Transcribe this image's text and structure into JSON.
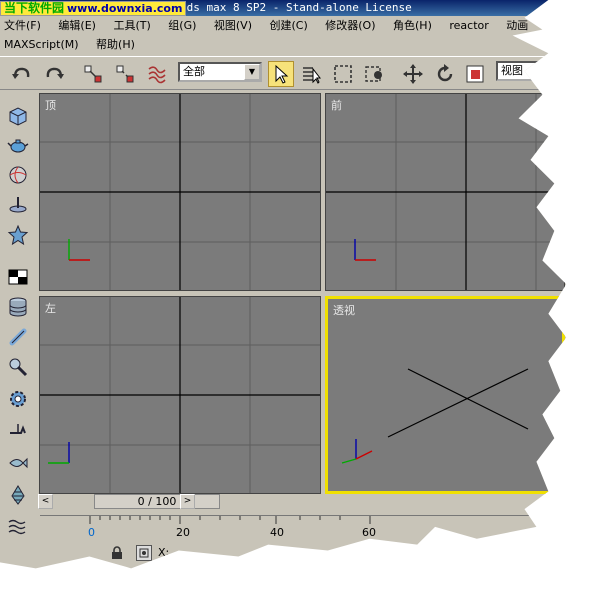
{
  "window": {
    "title_left": "3ds max 8 SP2",
    "title_right": "- Stand-alone License",
    "logo_text": "当下软件园",
    "logo_url": "www.downxia.com"
  },
  "menu": {
    "row1": [
      "文件(F)",
      "编辑(E)",
      "工具(T)",
      "组(G)",
      "视图(V)",
      "创建(C)",
      "修改器(O)",
      "角色(H)",
      "reactor",
      "动画"
    ],
    "row2": [
      "MAXScript(M)",
      "帮助(H)"
    ]
  },
  "toolbar": {
    "selection_filter": "全部",
    "reference_coord": "视图",
    "icons": [
      "undo-icon",
      "redo-icon",
      "select-link-icon",
      "unlink-icon",
      "bind-spacewarp-icon",
      "select-object-icon",
      "select-by-name-icon",
      "rect-region-icon",
      "window-crossing-icon",
      "move-icon",
      "rotate-icon",
      "scale-icon"
    ]
  },
  "command_tabs": [
    "box-icon",
    "teapot-icon",
    "sphere-icon",
    "plane-icon",
    "star-icon",
    "checker-icon",
    "cylinder-icon",
    "bone-icon",
    "clamp-icon",
    "gear-icon",
    "wrench-icon",
    "fish-icon",
    "pinecone-icon",
    "wave-icon"
  ],
  "viewports": [
    {
      "label": "顶",
      "active": false
    },
    {
      "label": "前",
      "active": false
    },
    {
      "label": "左",
      "active": false
    },
    {
      "label": "透视",
      "active": true
    }
  ],
  "timeline": {
    "frame_display": "0 / 100",
    "ruler_ticks": [
      "0",
      "20",
      "40",
      "60"
    ]
  },
  "status": {
    "x_label": "X:"
  },
  "colors": {
    "viewport_bg": "#7b7b7b",
    "active_border": "#f0e000",
    "title_bar": "#0a246a"
  }
}
